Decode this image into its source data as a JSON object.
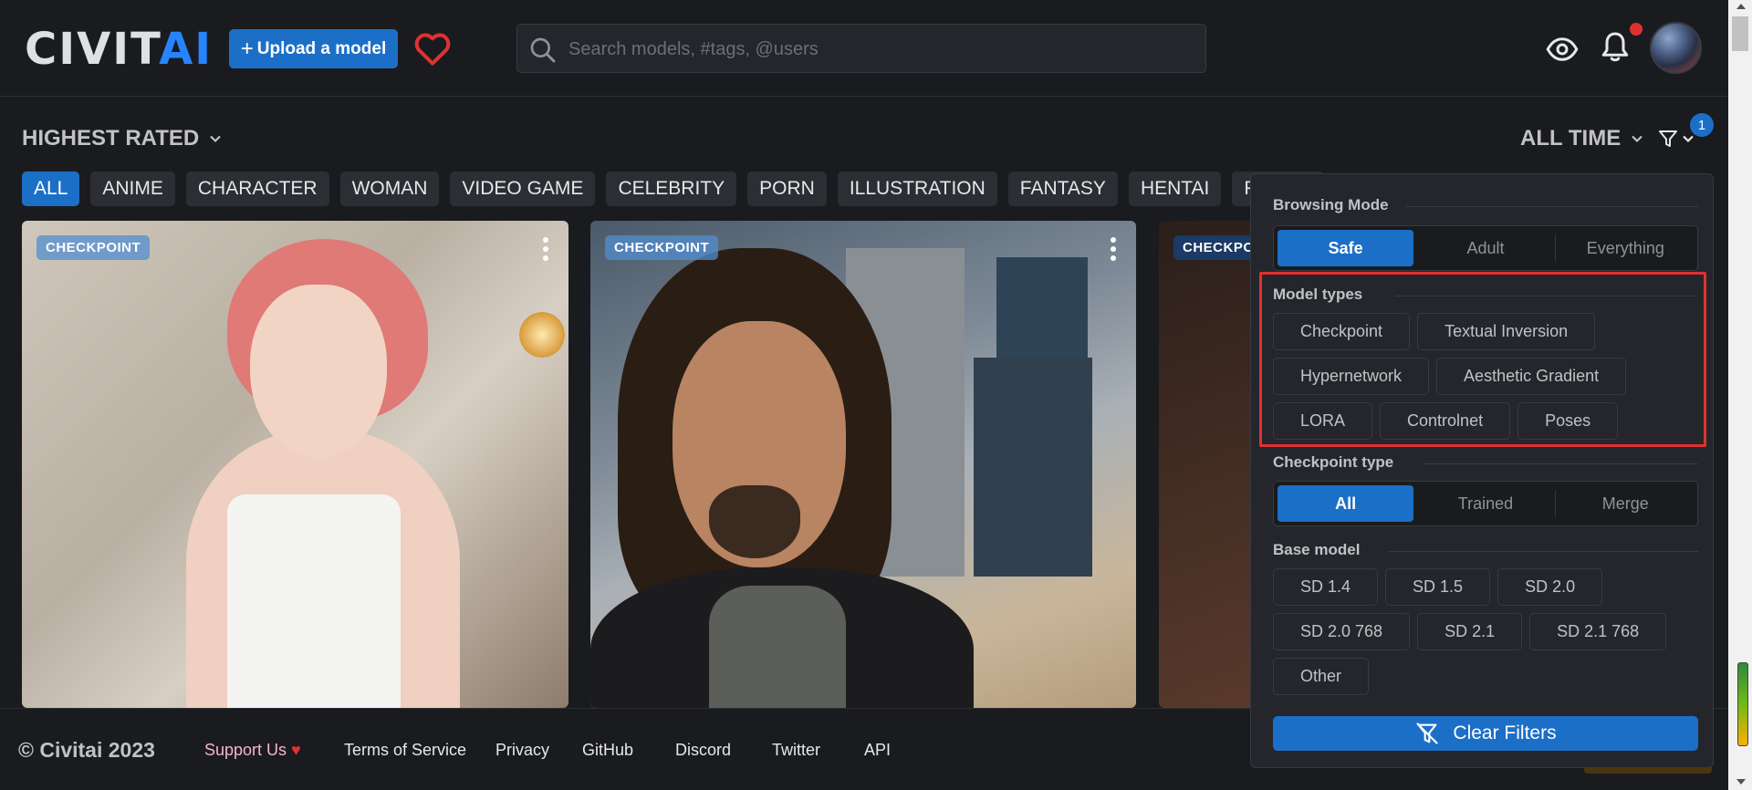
{
  "header": {
    "logo_part1": "CIVIT",
    "logo_part2": "AI",
    "upload_label": "Upload a model",
    "search_placeholder": "Search models, #tags, @users",
    "notification_dot": true
  },
  "sort": {
    "label": "HIGHEST RATED",
    "period": "ALL TIME",
    "filter_count": "1"
  },
  "tags": [
    "ALL",
    "ANIME",
    "CHARACTER",
    "WOMAN",
    "VIDEO GAME",
    "CELEBRITY",
    "PORN",
    "ILLUSTRATION",
    "FANTASY",
    "HENTAI",
    "PHOTO"
  ],
  "cards": [
    {
      "badge": "CHECKPOINT"
    },
    {
      "badge": "CHECKPOINT"
    },
    {
      "badge": "CHECKPO"
    }
  ],
  "filters": {
    "browsing_mode": {
      "title": "Browsing Mode",
      "options": [
        "Safe",
        "Adult",
        "Everything"
      ],
      "selected": "Safe"
    },
    "model_types": {
      "title": "Model types",
      "options": [
        "Checkpoint",
        "Textual Inversion",
        "Hypernetwork",
        "Aesthetic Gradient",
        "LORA",
        "Controlnet",
        "Poses"
      ]
    },
    "checkpoint_type": {
      "title": "Checkpoint type",
      "options": [
        "All",
        "Trained",
        "Merge"
      ],
      "selected": "All"
    },
    "base_model": {
      "title": "Base model",
      "options": [
        "SD 1.4",
        "SD 1.5",
        "SD 2.0",
        "SD 2.0 768",
        "SD 2.1",
        "SD 2.1 768",
        "Other"
      ]
    },
    "clear_label": "Clear Filters"
  },
  "footer": {
    "copyright": "© Civitai 2023",
    "support": "Support Us",
    "links": [
      "Terms of Service",
      "Privacy",
      "GitHub",
      "Discord",
      "Twitter",
      "API"
    ]
  },
  "colors": {
    "accent": "#1c6fc7",
    "background": "#1a1b1e",
    "panel": "#25262b",
    "highlight": "#e03131",
    "heart": "#e03131"
  }
}
